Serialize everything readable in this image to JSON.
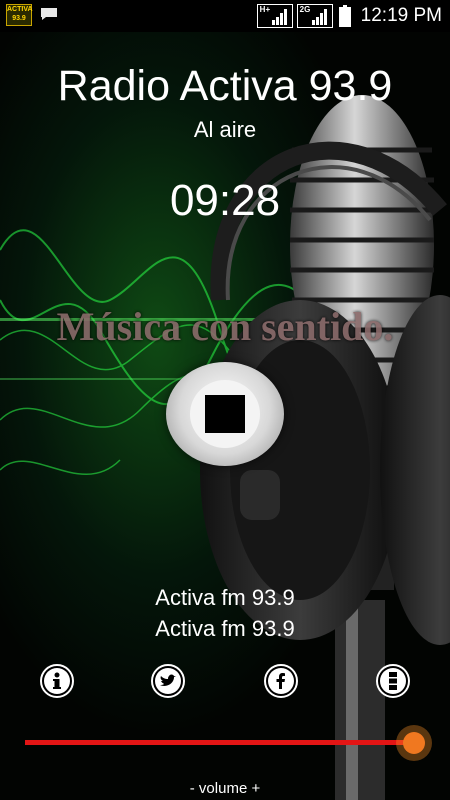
{
  "status_bar": {
    "app_icon_text": "ACTIVA 93.9",
    "network1_label": "H+",
    "network2_label": "2G",
    "time": "12:19 PM"
  },
  "station": {
    "name": "Radio Activa 93.9",
    "status": "Al aire",
    "elapsed": "09:28",
    "slogan": "Música con sentido."
  },
  "now_playing": {
    "line1": "Activa fm 93.9",
    "line2": "Activa fm 93.9"
  },
  "controls": {
    "icons": [
      "stop-icon",
      "info-icon",
      "twitter-icon",
      "facebook-icon",
      "menu-icon"
    ]
  },
  "volume": {
    "label": "- volume +",
    "level": 1.0
  },
  "colors": {
    "volume_track": "#e31515",
    "volume_knob": "#f07820",
    "accent_green": "#2cff4a"
  }
}
